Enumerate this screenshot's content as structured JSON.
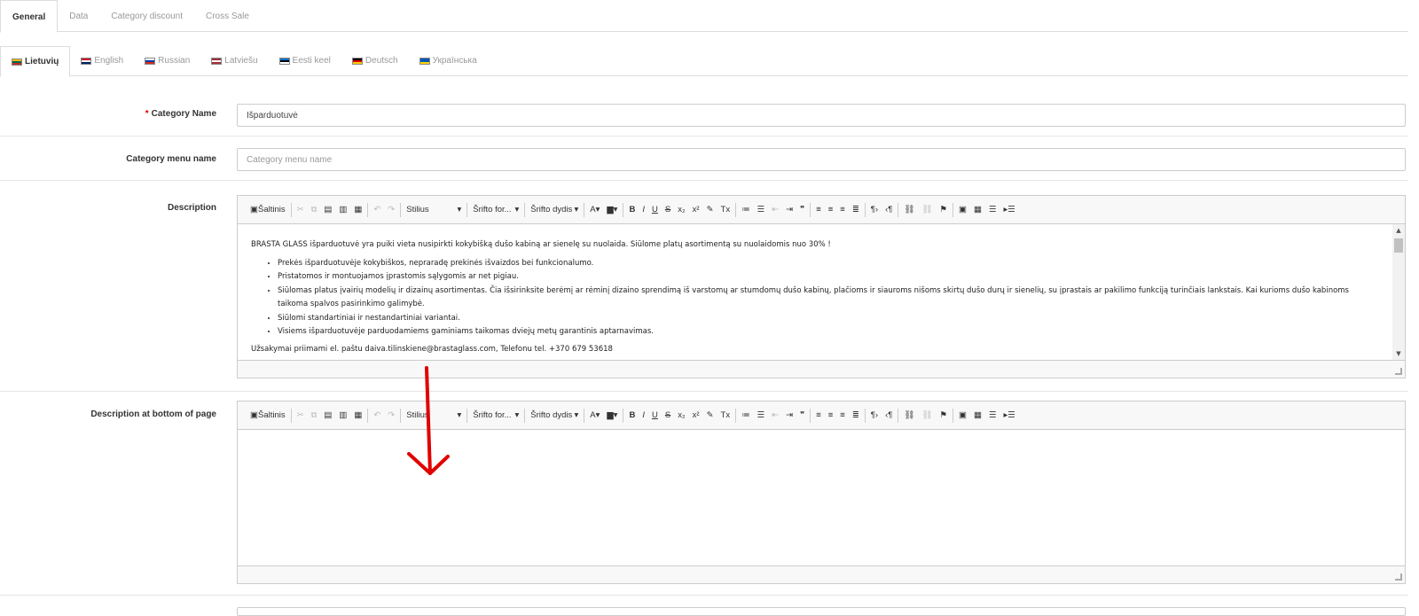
{
  "tabs": [
    "General",
    "Data",
    "Category discount",
    "Cross Sale"
  ],
  "languages": [
    {
      "label": "Lietuvių",
      "flag": [
        "#fdb913",
        "#006a44",
        "#c1272d"
      ]
    },
    {
      "label": "English",
      "flag": [
        "#c8102e",
        "#ffffff",
        "#012169"
      ]
    },
    {
      "label": "Russian",
      "flag": [
        "#ffffff",
        "#0039a6",
        "#d52b1e"
      ]
    },
    {
      "label": "Latviešu",
      "flag": [
        "#9e3039",
        "#ffffff",
        "#9e3039"
      ]
    },
    {
      "label": "Eesti keel",
      "flag": [
        "#0072ce",
        "#000000",
        "#ffffff"
      ]
    },
    {
      "label": "Deutsch",
      "flag": [
        "#000000",
        "#dd0000",
        "#ffce00"
      ]
    },
    {
      "label": "Українська",
      "flag": [
        "#0057b7",
        "#0057b7",
        "#ffd700"
      ]
    }
  ],
  "form": {
    "category_name_label": "Category Name",
    "required_mark": "*",
    "category_name_value": "Išparduotuvė",
    "menu_name_label": "Category menu name",
    "menu_name_placeholder": "Category menu name",
    "description_label": "Description",
    "description_bottom_label": "Description at bottom of page"
  },
  "toolbar": {
    "source": "Šaltinis",
    "style": "Stilius",
    "font": "Šrifto for...",
    "size": "Šrifto dydis",
    "icons": [
      "cut-icon",
      "copy-icon",
      "paste-icon",
      "paste-text-icon",
      "paste-word-icon",
      "undo-icon",
      "redo-icon",
      "text-color-icon",
      "bg-color-icon",
      "bold-icon",
      "italic-icon",
      "underline-icon",
      "strike-icon",
      "subscript-icon",
      "superscript-icon",
      "copy-format-icon",
      "remove-format-icon",
      "numbered-list-icon",
      "bulleted-list-icon",
      "outdent-icon",
      "indent-icon",
      "blockquote-icon",
      "align-left-icon",
      "align-center-icon",
      "align-right-icon",
      "justify-icon",
      "ltr-icon",
      "rtl-icon",
      "link-icon",
      "unlink-icon",
      "anchor-icon",
      "image-icon",
      "table-icon",
      "hr-icon",
      "show-blocks-icon"
    ]
  },
  "description": {
    "intro": "BRASTA GLASS išparduotuvė yra puiki vieta nusipirkti kokybišką dušo kabiną ar sienelę su nuolaida. Siūlome platų asortimentą su nuolaidomis nuo 30% !",
    "bullets": [
      "Prekės išparduotuvėje kokybiškos, nepraradę prekinės išvaizdos bei funkcionalumo.",
      "Pristatomos ir montuojamos įprastomis sąlygomis ar net pigiau.",
      "Siūlomas platus įvairių modelių ir dizainų asortimentas. Čia išsirinksite berėmį ar rėminį dizaino sprendimą iš varstomų ar stumdomų dušo kabinų, plačioms ir siauroms nišoms skirtų dušo durų ir sienelių, su įprastais ar pakilimo funkciją turinčiais lankstais. Kai kurioms dušo kabinoms taikoma spalvos pasirinkimo galimybė.",
      "Siūlomi standartiniai ir nestandartiniai variantai.",
      "Visiems išparduotuvėje parduodamiems gaminiams taikomas dviejų metų garantinis aptarnavimas."
    ],
    "cut_line": "Užsakymai priimami el. paštu daiva.tilinskiene@brastaglass.com, Telefonu tel. +370 679 53618"
  },
  "annotation_color": "#e00000"
}
